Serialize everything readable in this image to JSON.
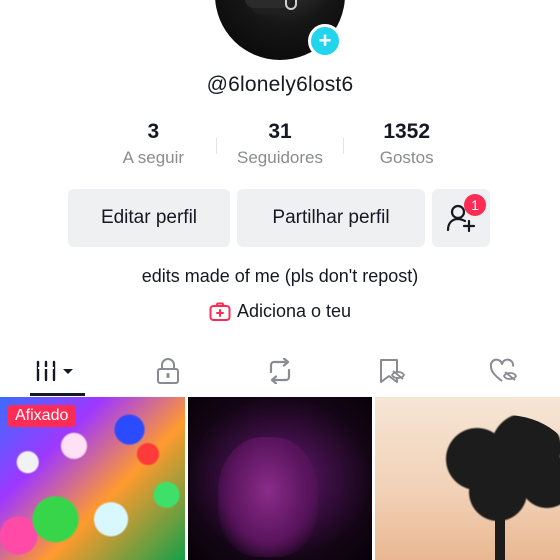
{
  "profile": {
    "username": "@6lonely6lost6",
    "bio": "edits made of me (pls don't repost)",
    "add_link_label": "Adiciona o teu"
  },
  "stats": [
    {
      "value": "3",
      "label": "A seguir"
    },
    {
      "value": "31",
      "label": "Seguidores"
    },
    {
      "value": "1352",
      "label": "Gostos"
    }
  ],
  "actions": {
    "edit_label": "Editar perfil",
    "share_label": "Partilhar perfil",
    "friend_requests_count": "1"
  },
  "tabs": [
    {
      "icon": "grid-icon",
      "active": true
    },
    {
      "icon": "lock-icon",
      "active": false
    },
    {
      "icon": "repost-icon",
      "active": false
    },
    {
      "icon": "bookmark-hidden-icon",
      "active": false
    },
    {
      "icon": "liked-hidden-icon",
      "active": false
    }
  ],
  "videos": {
    "pinned_label": "Afixado"
  },
  "colors": {
    "accent": "#fe2c55",
    "add_badge": "#20d5ec",
    "text_primary": "#161823",
    "text_secondary": "#8a8b91",
    "button_bg": "#eff0f1"
  }
}
